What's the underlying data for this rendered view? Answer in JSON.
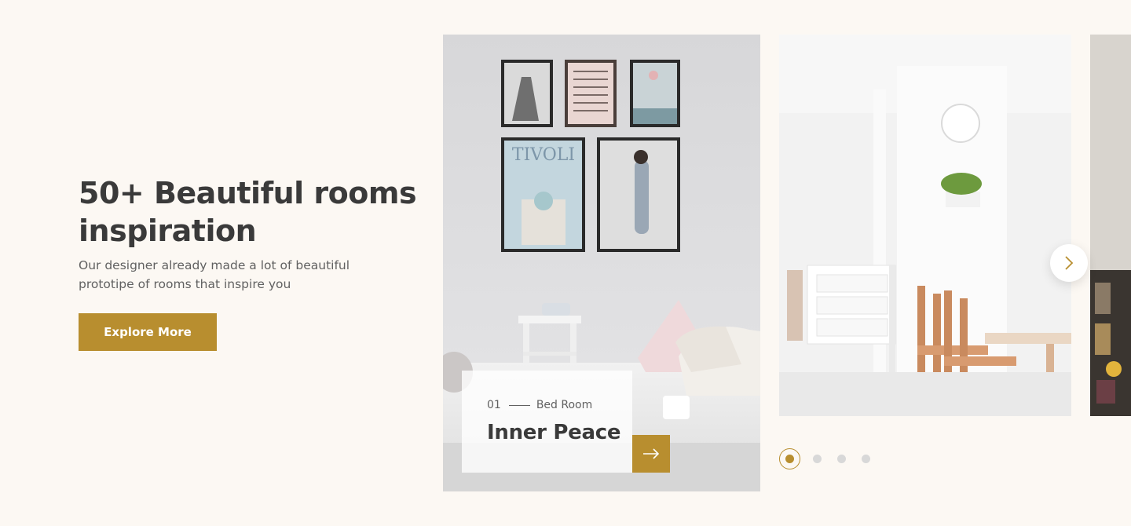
{
  "hero": {
    "title": "50+ Beautiful rooms inspiration",
    "description": "Our designer already made a lot of beautiful prototipe of rooms that inspire you",
    "cta_label": "Explore More"
  },
  "slider": {
    "active": {
      "number": "01",
      "category": "Bed Room",
      "title": "Inner Peace"
    },
    "slides": [
      {
        "image": "bedroom-photo"
      },
      {
        "image": "dining-room-photo"
      },
      {
        "image": "kitchen-photo"
      }
    ],
    "dots": {
      "count": 4,
      "active_index": 0
    }
  },
  "icons": {
    "caption_arrow": "arrow-right-icon",
    "next": "chevron-right-icon"
  },
  "colors": {
    "accent": "#B88E2F",
    "background": "#FCF8F3",
    "heading": "#3A3A3A",
    "body_text": "#616161",
    "inactive_dot": "#D8D8D8"
  }
}
